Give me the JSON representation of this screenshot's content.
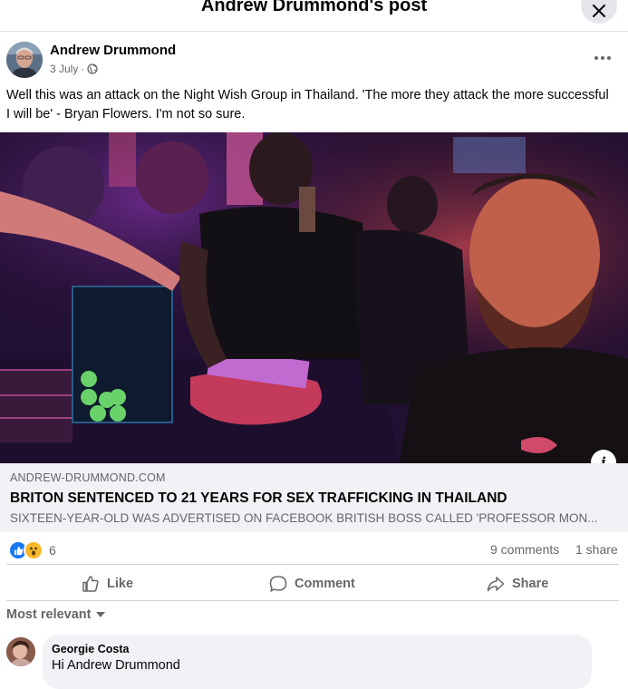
{
  "header": {
    "title": "Andrew Drummond's post"
  },
  "post": {
    "author": "Andrew Drummond",
    "date": "3 July",
    "date_separator": "·",
    "text": "Well this was an attack on the Night Wish Group in Thailand. 'The more they attack the more successful I will be' - Bryan Flowers. I'm not so sure."
  },
  "link": {
    "domain": "ANDREW-DRUMMOND.COM",
    "title": "BRITON SENTENCED TO 21 YEARS FOR SEX TRAFFICKING IN THAILAND",
    "description": "SIXTEEN-YEAR-OLD WAS ADVERTISED ON FACEBOOK BRITISH BOSS CALLED 'PROFESSOR MON..."
  },
  "stats": {
    "reaction_count": "6",
    "comments": "9 comments",
    "shares": "1 share"
  },
  "actions": {
    "like": "Like",
    "comment": "Comment",
    "share": "Share"
  },
  "sort": {
    "label": "Most relevant"
  },
  "comment": {
    "author": "Georgie Costa",
    "greeting": "Hi",
    "mention": "Andrew Drummond"
  },
  "colors": {
    "like_blue": "#1877f2",
    "wow_yellow": "#f7b928",
    "secondary_text": "#65676b",
    "link_box_bg": "#f0f2f5"
  },
  "icons": [
    "close-icon",
    "globe-icon",
    "more-icon",
    "info-icon",
    "like-reaction-icon",
    "wow-reaction-icon",
    "thumb-up-icon",
    "comment-icon",
    "share-icon",
    "caret-down-icon"
  ]
}
